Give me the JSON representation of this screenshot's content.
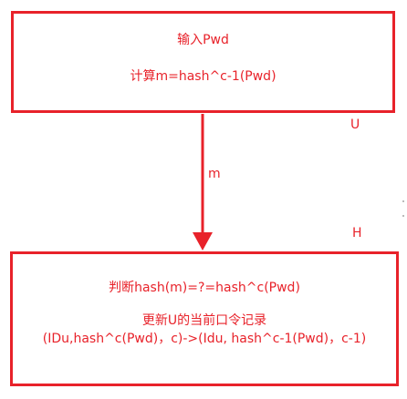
{
  "user_box": {
    "line1": "输入Pwd",
    "line2": "计算m=hash^c-1(Pwd)"
  },
  "server_box": {
    "line1": "判断hash(m)=?=hash^c(Pwd)",
    "line2": "更新U的当前口令记录",
    "line3": "(IDu,hash^c(Pwd)，c)->(Idu, hash^c-1(Pwd)，c-1)"
  },
  "labels": {
    "user": "U",
    "message": "m",
    "server": "H"
  },
  "colors": {
    "accent": "#e8222a",
    "background": "#ffffff"
  }
}
